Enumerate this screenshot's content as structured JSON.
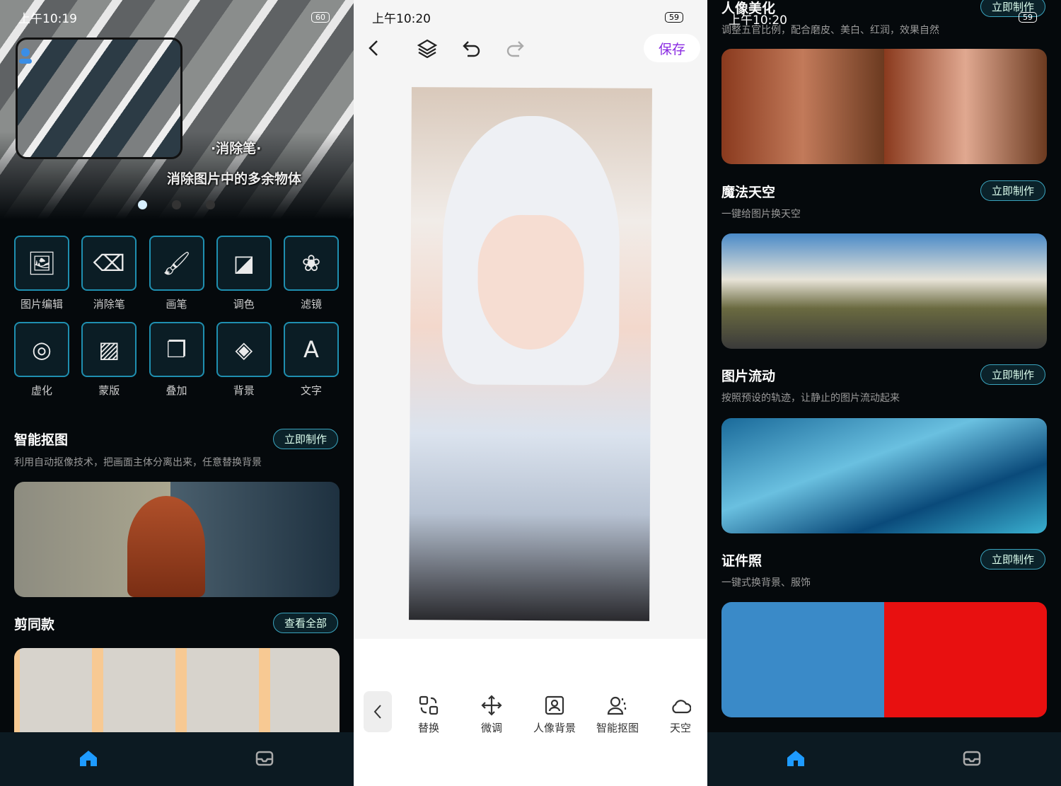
{
  "left": {
    "status": {
      "time": "上午10:19",
      "battery": "60"
    },
    "banner": {
      "title": "·消除笔·",
      "subtitle": "消除图片中的多余物体",
      "page_dots": 3,
      "active_dot": 0
    },
    "tools": [
      {
        "label": "图片编辑",
        "icon": "image-icon"
      },
      {
        "label": "消除笔",
        "icon": "eraser-icon"
      },
      {
        "label": "画笔",
        "icon": "brush-icon"
      },
      {
        "label": "调色",
        "icon": "paint-bucket-icon"
      },
      {
        "label": "滤镜",
        "icon": "filter-icon"
      },
      {
        "label": "虚化",
        "icon": "blur-icon"
      },
      {
        "label": "蒙版",
        "icon": "mask-icon"
      },
      {
        "label": "叠加",
        "icon": "overlay-icon"
      },
      {
        "label": "背景",
        "icon": "background-icon"
      },
      {
        "label": "文字",
        "icon": "text-icon"
      }
    ],
    "cutout": {
      "title": "智能抠图",
      "button": "立即制作",
      "desc": "利用自动抠像技术，把画面主体分离出来，任意替换背景"
    },
    "templates": {
      "title": "剪同款",
      "button": "查看全部"
    },
    "nav": [
      "home-icon",
      "inbox-icon"
    ]
  },
  "middle": {
    "status": {
      "time": "上午10:20",
      "battery": "59"
    },
    "toolbar": {
      "save": "保存"
    },
    "tools": [
      {
        "label": "替换",
        "icon": "replace-icon"
      },
      {
        "label": "微调",
        "icon": "move-icon"
      },
      {
        "label": "人像背景",
        "icon": "portrait-icon"
      },
      {
        "label": "智能抠图",
        "icon": "person-cutout-icon"
      },
      {
        "label": "天空",
        "icon": "cloud-icon"
      }
    ]
  },
  "right": {
    "status": {
      "time": "上午10:20",
      "battery": "59"
    },
    "sections": [
      {
        "title": "人像美化",
        "button": "立即制作",
        "desc": "调整五官比例，配合磨皮、美白、红润，效果自然"
      },
      {
        "title": "魔法天空",
        "button": "立即制作",
        "desc": "一键给图片换天空"
      },
      {
        "title": "图片流动",
        "button": "立即制作",
        "desc": "按照预设的轨迹，让静止的图片流动起来"
      },
      {
        "title": "证件照",
        "button": "立即制作",
        "desc": "一键式换背景、服饰"
      }
    ]
  },
  "colors": {
    "accent": "#1f8fb0",
    "save": "#8a2be2",
    "nav_active": "#1e9bff"
  }
}
